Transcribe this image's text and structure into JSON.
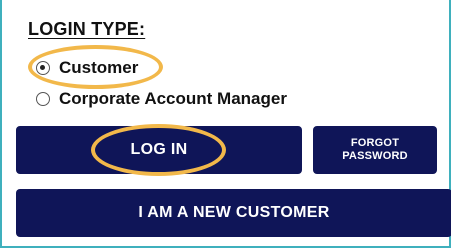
{
  "login_type": {
    "title": "LOGIN TYPE:",
    "options": [
      {
        "label": "Customer",
        "selected": true
      },
      {
        "label": "Corporate Account Manager",
        "selected": false
      }
    ]
  },
  "buttons": {
    "login_label": "LOG IN",
    "forgot_label": "FORGOT PASSWORD",
    "new_customer_label": "I AM A NEW CUSTOMER"
  },
  "colors": {
    "button_background": "#0f1558",
    "button_text": "#ffffff",
    "highlight_ring": "#f2b84a",
    "panel_border": "#3fb0bd"
  }
}
